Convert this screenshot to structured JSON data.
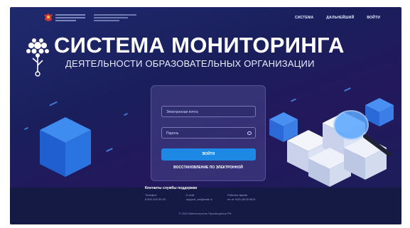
{
  "header": {
    "nav": [
      "СИСТЕМА",
      "ДАЛЬНЕЙШИЙ",
      "ВОЙТИ"
    ]
  },
  "hero": {
    "title": "СИСТЕМА МОНИТОРИНГА",
    "subtitle": "ДЕЯТЕЛЬНОСТИ ОБРАЗОВАТЕЛЬНЫХ ОРГАНИЗАЦИИ"
  },
  "login": {
    "username_placeholder": "Электронная почта",
    "password_placeholder": "Пароль",
    "submit_label": "ВОЙТИ",
    "forgot_label": "ВОССТАНОВЛЕНИЕ ПО ЭЛЕКТРОННОЙ"
  },
  "footer": {
    "support_title": "Контакты службы поддержки",
    "col1": [
      "Телефон",
      "8 800 000 00 00"
    ],
    "col2": [
      "E-mail",
      "support_sm@mail.ru"
    ],
    "col3": [
      "Рабочее время",
      "пн-пт 9:00-18:00 МСК"
    ],
    "copyright": "© 2022 Министерство Просвещения РФ"
  },
  "colors": {
    "accent": "#1e88e5",
    "background": "#1f2a6e",
    "footer": "#151a45"
  }
}
